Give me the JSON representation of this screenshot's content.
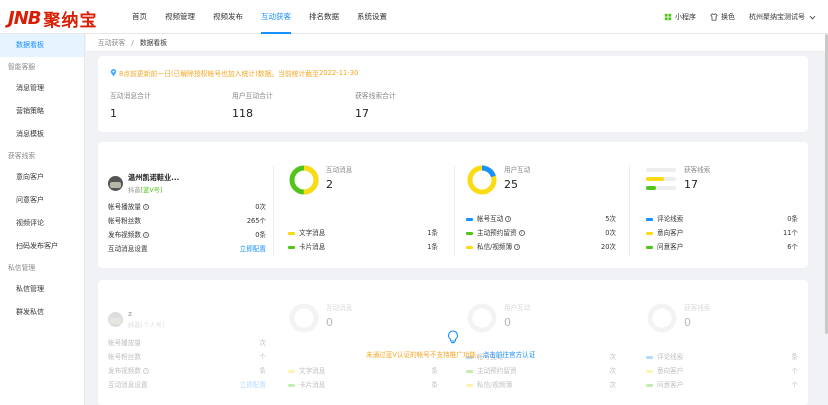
{
  "logo": {
    "mark": "JNB",
    "text": "聚纳宝"
  },
  "nav": [
    "首页",
    "视频管理",
    "视频发布",
    "互动获客",
    "排名数据",
    "系统设置"
  ],
  "nav_active_index": 3,
  "top_right": {
    "mini_program": "小程序",
    "skin": "换色",
    "account": "杭州聚纳宝测试号"
  },
  "sidebar": {
    "top_item": "数据看板",
    "groups": [
      {
        "title": "智能客服",
        "items": [
          "消息管理",
          "营销策略",
          "消息模板"
        ]
      },
      {
        "title": "获客线索",
        "items": [
          "意向客户",
          "问意客户",
          "视频评论",
          "扫码发布客户"
        ]
      },
      {
        "title": "私信管理",
        "items": [
          "私信管理",
          "群发私信"
        ]
      }
    ]
  },
  "breadcrumb": {
    "parent": "互动获客",
    "sep": "/",
    "current": "数据看板"
  },
  "summary": {
    "notice_prefix": "8点前更新前一日(已解除授权帐号也加入统计)数据。当前统计截至",
    "notice_date": "2022-11-30",
    "stats": [
      {
        "label": "互动消息合计",
        "value": "1"
      },
      {
        "label": "用户互动合计",
        "value": "118"
      },
      {
        "label": "获客线索合计",
        "value": "17"
      }
    ]
  },
  "cards": [
    {
      "account": {
        "name": "温州凯诺鞋业...",
        "platform": "抖音",
        "tag": "[蓝V号]"
      },
      "rows": [
        {
          "label": "帐号播放量",
          "info": true,
          "value": "0次"
        },
        {
          "label": "帐号粉丝数",
          "info": false,
          "value": "265个"
        },
        {
          "label": "发布视频数",
          "info": true,
          "value": "0条"
        },
        {
          "label": "互动消息设置",
          "info": false,
          "value": "立即配置",
          "link": true
        }
      ],
      "metrics": [
        {
          "label": "互动消息",
          "value": "2",
          "rows": [
            {
              "label": "文字消息",
              "value": "1条",
              "color": "#fadb14"
            },
            {
              "label": "卡片消息",
              "value": "1条",
              "color": "#52c41a"
            }
          ]
        },
        {
          "label": "用户互动",
          "value": "25",
          "rows": [
            {
              "label": "帐号互动",
              "value": "5次",
              "color": "#1890ff",
              "info": true
            },
            {
              "label": "主动预约留资",
              "value": "0次",
              "color": "#52c41a",
              "info": true
            },
            {
              "label": "私信/视频簿",
              "value": "20次",
              "color": "#fadb14",
              "info": true
            }
          ]
        },
        {
          "label": "获客线索",
          "value": "17",
          "rows": [
            {
              "label": "评论线索",
              "value": "0条",
              "color": "#1890ff"
            },
            {
              "label": "意向客户",
              "value": "11个",
              "color": "#fadb14"
            },
            {
              "label": "问意客户",
              "value": "6个",
              "color": "#52c41a"
            }
          ]
        }
      ]
    },
    {
      "account": {
        "name": "z",
        "platform": "抖音",
        "tag": "[个人号]"
      },
      "rows": [
        {
          "label": "帐号播放量",
          "info": false,
          "value": "次"
        },
        {
          "label": "帐号粉丝数",
          "info": false,
          "value": "个"
        },
        {
          "label": "发布视频数",
          "info": true,
          "value": "条"
        },
        {
          "label": "互动消息设置",
          "info": false,
          "value": "立即配置",
          "link": true
        }
      ],
      "metrics": [
        {
          "label": "互动消息",
          "value": "0",
          "rows": [
            {
              "label": "文字消息",
              "value": "条",
              "color": "#fadb14"
            },
            {
              "label": "卡片消息",
              "value": "条",
              "color": "#52c41a"
            }
          ]
        },
        {
          "label": "用户互动",
          "value": "0",
          "rows": [
            {
              "label": "帐号互动",
              "value": "次",
              "color": "#1890ff",
              "info": true
            },
            {
              "label": "主动预约留资",
              "value": "次",
              "color": "#52c41a",
              "info": true
            },
            {
              "label": "私信/视频簿",
              "value": "次",
              "color": "#fadb14",
              "info": true
            }
          ]
        },
        {
          "label": "获客线索",
          "value": "0",
          "rows": [
            {
              "label": "评论线索",
              "value": "条",
              "color": "#1890ff"
            },
            {
              "label": "意向客户",
              "value": "个",
              "color": "#fadb14"
            },
            {
              "label": "问意客户",
              "value": "个",
              "color": "#52c41a"
            }
          ]
        }
      ]
    }
  ],
  "overlay": {
    "message": "未通过蓝V认证的帐号不支持推广功能，",
    "link": "点击前往官方认证"
  }
}
